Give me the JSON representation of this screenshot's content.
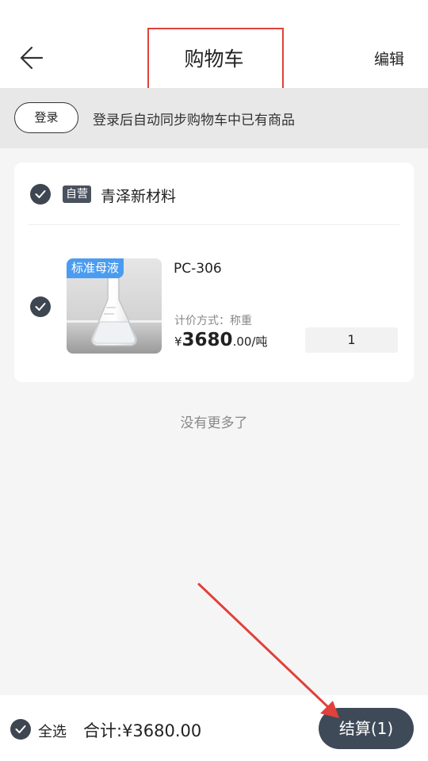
{
  "header": {
    "title": "购物车",
    "edit_label": "编辑",
    "back_icon": "arrow-left-icon"
  },
  "login_banner": {
    "button_label": "登录",
    "tip": "登录后自动同步购物车中已有商品"
  },
  "shop": {
    "tag": "自营",
    "name": "青泽新材料",
    "checked": true,
    "items": [
      {
        "image_tag": "标准母液",
        "code": "PC-306",
        "price_method": "计价方式：称重",
        "currency": "¥",
        "price_int": "3680",
        "price_dec": ".00/吨",
        "quantity": "1",
        "checked": true
      }
    ]
  },
  "list_footer": "没有更多了",
  "bottom_bar": {
    "select_all_label": "全选",
    "total_label": "合计:¥3680.00",
    "checkout_label": "结算(1)"
  },
  "colors": {
    "accent_dark": "#3f4a58",
    "tag_blue": "#4a9cf0",
    "annotation_red": "#e0413a"
  }
}
